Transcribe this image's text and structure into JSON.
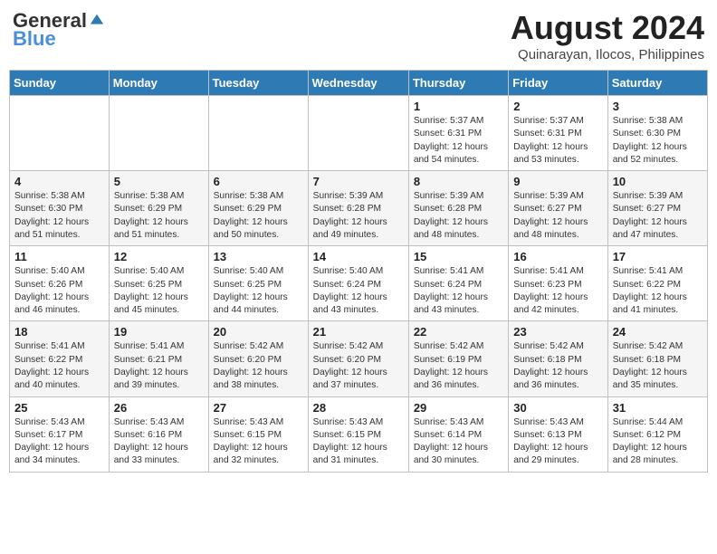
{
  "header": {
    "logo_general": "General",
    "logo_blue": "Blue",
    "title": "August 2024",
    "location": "Quinarayan, Ilocos, Philippines"
  },
  "days_of_week": [
    "Sunday",
    "Monday",
    "Tuesday",
    "Wednesday",
    "Thursday",
    "Friday",
    "Saturday"
  ],
  "weeks": [
    [
      {
        "day": "",
        "info": ""
      },
      {
        "day": "",
        "info": ""
      },
      {
        "day": "",
        "info": ""
      },
      {
        "day": "",
        "info": ""
      },
      {
        "day": "1",
        "info": "Sunrise: 5:37 AM\nSunset: 6:31 PM\nDaylight: 12 hours\nand 54 minutes."
      },
      {
        "day": "2",
        "info": "Sunrise: 5:37 AM\nSunset: 6:31 PM\nDaylight: 12 hours\nand 53 minutes."
      },
      {
        "day": "3",
        "info": "Sunrise: 5:38 AM\nSunset: 6:30 PM\nDaylight: 12 hours\nand 52 minutes."
      }
    ],
    [
      {
        "day": "4",
        "info": "Sunrise: 5:38 AM\nSunset: 6:30 PM\nDaylight: 12 hours\nand 51 minutes."
      },
      {
        "day": "5",
        "info": "Sunrise: 5:38 AM\nSunset: 6:29 PM\nDaylight: 12 hours\nand 51 minutes."
      },
      {
        "day": "6",
        "info": "Sunrise: 5:38 AM\nSunset: 6:29 PM\nDaylight: 12 hours\nand 50 minutes."
      },
      {
        "day": "7",
        "info": "Sunrise: 5:39 AM\nSunset: 6:28 PM\nDaylight: 12 hours\nand 49 minutes."
      },
      {
        "day": "8",
        "info": "Sunrise: 5:39 AM\nSunset: 6:28 PM\nDaylight: 12 hours\nand 48 minutes."
      },
      {
        "day": "9",
        "info": "Sunrise: 5:39 AM\nSunset: 6:27 PM\nDaylight: 12 hours\nand 48 minutes."
      },
      {
        "day": "10",
        "info": "Sunrise: 5:39 AM\nSunset: 6:27 PM\nDaylight: 12 hours\nand 47 minutes."
      }
    ],
    [
      {
        "day": "11",
        "info": "Sunrise: 5:40 AM\nSunset: 6:26 PM\nDaylight: 12 hours\nand 46 minutes."
      },
      {
        "day": "12",
        "info": "Sunrise: 5:40 AM\nSunset: 6:25 PM\nDaylight: 12 hours\nand 45 minutes."
      },
      {
        "day": "13",
        "info": "Sunrise: 5:40 AM\nSunset: 6:25 PM\nDaylight: 12 hours\nand 44 minutes."
      },
      {
        "day": "14",
        "info": "Sunrise: 5:40 AM\nSunset: 6:24 PM\nDaylight: 12 hours\nand 43 minutes."
      },
      {
        "day": "15",
        "info": "Sunrise: 5:41 AM\nSunset: 6:24 PM\nDaylight: 12 hours\nand 43 minutes."
      },
      {
        "day": "16",
        "info": "Sunrise: 5:41 AM\nSunset: 6:23 PM\nDaylight: 12 hours\nand 42 minutes."
      },
      {
        "day": "17",
        "info": "Sunrise: 5:41 AM\nSunset: 6:22 PM\nDaylight: 12 hours\nand 41 minutes."
      }
    ],
    [
      {
        "day": "18",
        "info": "Sunrise: 5:41 AM\nSunset: 6:22 PM\nDaylight: 12 hours\nand 40 minutes."
      },
      {
        "day": "19",
        "info": "Sunrise: 5:41 AM\nSunset: 6:21 PM\nDaylight: 12 hours\nand 39 minutes."
      },
      {
        "day": "20",
        "info": "Sunrise: 5:42 AM\nSunset: 6:20 PM\nDaylight: 12 hours\nand 38 minutes."
      },
      {
        "day": "21",
        "info": "Sunrise: 5:42 AM\nSunset: 6:20 PM\nDaylight: 12 hours\nand 37 minutes."
      },
      {
        "day": "22",
        "info": "Sunrise: 5:42 AM\nSunset: 6:19 PM\nDaylight: 12 hours\nand 36 minutes."
      },
      {
        "day": "23",
        "info": "Sunrise: 5:42 AM\nSunset: 6:18 PM\nDaylight: 12 hours\nand 36 minutes."
      },
      {
        "day": "24",
        "info": "Sunrise: 5:42 AM\nSunset: 6:18 PM\nDaylight: 12 hours\nand 35 minutes."
      }
    ],
    [
      {
        "day": "25",
        "info": "Sunrise: 5:43 AM\nSunset: 6:17 PM\nDaylight: 12 hours\nand 34 minutes."
      },
      {
        "day": "26",
        "info": "Sunrise: 5:43 AM\nSunset: 6:16 PM\nDaylight: 12 hours\nand 33 minutes."
      },
      {
        "day": "27",
        "info": "Sunrise: 5:43 AM\nSunset: 6:15 PM\nDaylight: 12 hours\nand 32 minutes."
      },
      {
        "day": "28",
        "info": "Sunrise: 5:43 AM\nSunset: 6:15 PM\nDaylight: 12 hours\nand 31 minutes."
      },
      {
        "day": "29",
        "info": "Sunrise: 5:43 AM\nSunset: 6:14 PM\nDaylight: 12 hours\nand 30 minutes."
      },
      {
        "day": "30",
        "info": "Sunrise: 5:43 AM\nSunset: 6:13 PM\nDaylight: 12 hours\nand 29 minutes."
      },
      {
        "day": "31",
        "info": "Sunrise: 5:44 AM\nSunset: 6:12 PM\nDaylight: 12 hours\nand 28 minutes."
      }
    ]
  ]
}
